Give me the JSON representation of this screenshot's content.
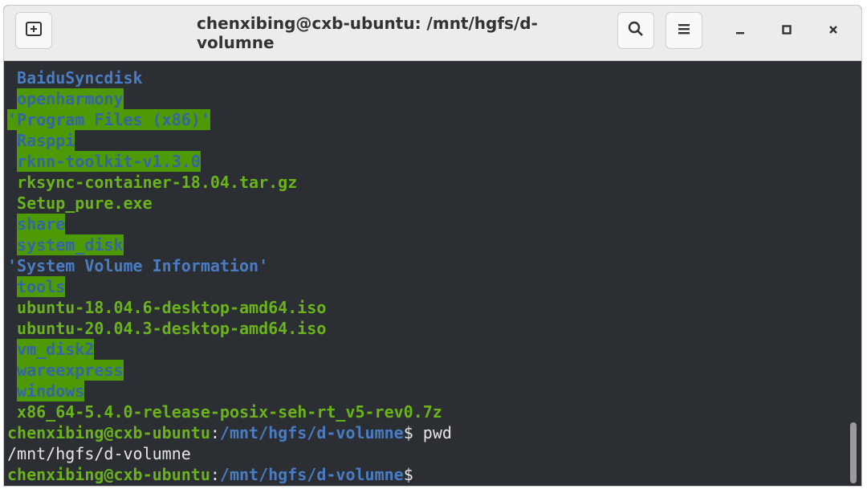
{
  "window": {
    "title": "chenxibing@cxb-ubuntu: /mnt/hgfs/d-volumne"
  },
  "icons": {
    "new_tab": "new-tab-icon",
    "search": "search-icon",
    "menu": "hamburger-menu-icon",
    "minimize": "minimize-icon",
    "maximize": "maximize-icon",
    "close": "close-icon"
  },
  "colors": {
    "terminal_bg": "#2b2f33",
    "dir_highlight_bg": "#4e9a06",
    "dir_text": "#3465a4",
    "file_green": "#6ab31a",
    "prompt_path_blue": "#4a7cc3"
  },
  "listing": [
    {
      "text": " BaiduSyncdisk",
      "style": "dir-plain"
    },
    {
      "text": "openharmony",
      "style": "dir-green"
    },
    {
      "text": "'Program Files (x86)'",
      "style": "dir-green-quoted"
    },
    {
      "text": "Rasppi",
      "style": "dir-green"
    },
    {
      "text": "rknn-toolkit-v1.3.0",
      "style": "dir-green"
    },
    {
      "text": " rksync-container-18.04.tar.gz",
      "style": "file-green"
    },
    {
      "text": " Setup_pure.exe",
      "style": "file-green"
    },
    {
      "text": "share",
      "style": "dir-green"
    },
    {
      "text": "system_disk",
      "style": "dir-green"
    },
    {
      "text": "'System Volume Information'",
      "style": "dir-plain-quoted"
    },
    {
      "text": "tools",
      "style": "dir-green"
    },
    {
      "text": " ubuntu-18.04.6-desktop-amd64.iso",
      "style": "file-green"
    },
    {
      "text": " ubuntu-20.04.3-desktop-amd64.iso",
      "style": "file-green"
    },
    {
      "text": "vm_disk2",
      "style": "dir-green"
    },
    {
      "text": "wareexpress",
      "style": "dir-green"
    },
    {
      "text": "windows",
      "style": "dir-green"
    },
    {
      "text": " x86_64-5.4.0-release-posix-seh-rt_v5-rev0.7z",
      "style": "file-green"
    }
  ],
  "prompt": {
    "user_host": "chenxibing@cxb-ubuntu",
    "colon": ":",
    "path": "/mnt/hgfs/d-volumne",
    "dollar": "$",
    "command1": " pwd",
    "output1": "/mnt/hgfs/d-volumne"
  }
}
